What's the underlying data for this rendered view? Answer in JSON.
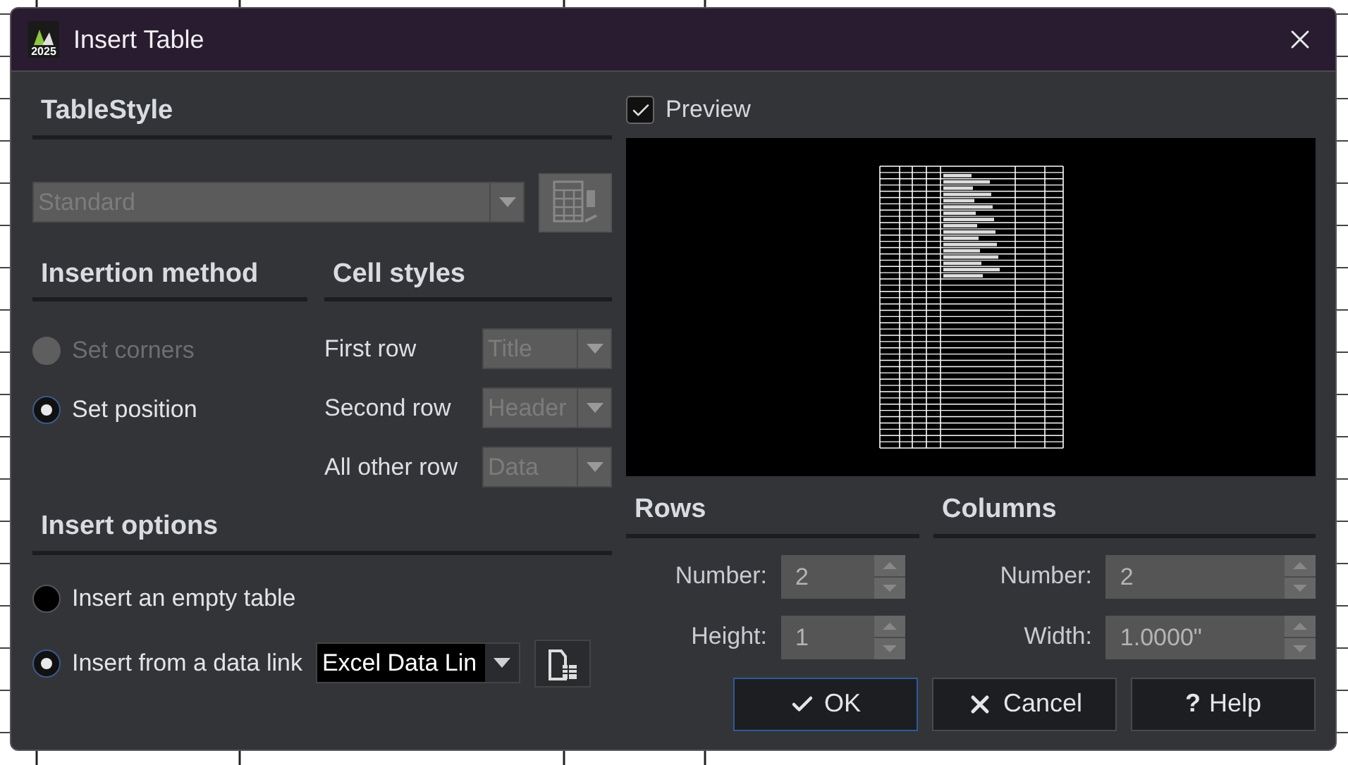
{
  "window": {
    "title": "Insert Table",
    "logo_text": "2025"
  },
  "table_style": {
    "heading": "TableStyle",
    "value": "Standard",
    "disabled": true
  },
  "insertion_method": {
    "heading": "Insertion method",
    "options": [
      {
        "label": "Set corners",
        "selected": false,
        "disabled": true
      },
      {
        "label": "Set position",
        "selected": true,
        "disabled": false
      }
    ]
  },
  "cell_styles": {
    "heading": "Cell styles",
    "disabled": true,
    "rows": [
      {
        "label": "First row",
        "value": "Title"
      },
      {
        "label": "Second row",
        "value": "Header"
      },
      {
        "label": "All other row",
        "value": "Data"
      }
    ]
  },
  "insert_options": {
    "heading": "Insert options",
    "options": [
      {
        "label": "Insert an empty table",
        "selected": false
      },
      {
        "label": "Insert from a data link",
        "selected": true
      }
    ],
    "data_link": {
      "value": "Excel Data Lin"
    }
  },
  "preview": {
    "label": "Preview",
    "checked": true
  },
  "rows": {
    "heading": "Rows",
    "disabled": true,
    "fields": [
      {
        "label": "Number:",
        "value": "2"
      },
      {
        "label": "Height:",
        "value": "1"
      }
    ]
  },
  "columns": {
    "heading": "Columns",
    "disabled": true,
    "fields": [
      {
        "label": "Number:",
        "value": "2"
      },
      {
        "label": "Width:",
        "value": "1.0000\""
      }
    ]
  },
  "buttons": [
    {
      "kind": "ok",
      "label": "OK",
      "default": true
    },
    {
      "kind": "cancel",
      "label": "Cancel",
      "default": false
    },
    {
      "kind": "help",
      "label": "Help",
      "symbol": "?",
      "default": false
    }
  ]
}
